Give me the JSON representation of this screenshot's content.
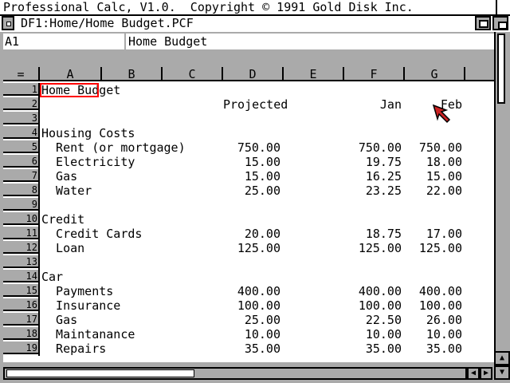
{
  "screen": {
    "title": "Professional Calc, V1.0.  Copyright © 1991 Gold Disk Inc."
  },
  "window": {
    "title": "DF1:Home/Home Budget.PCF"
  },
  "formula": {
    "cell_ref": "A1",
    "content": "Home Budget"
  },
  "columns": [
    {
      "label": "="
    },
    {
      "label": "A"
    },
    {
      "label": "B"
    },
    {
      "label": "C"
    },
    {
      "label": "D"
    },
    {
      "label": "E"
    },
    {
      "label": "F"
    },
    {
      "label": "G"
    }
  ],
  "rows": [
    {
      "num": "1",
      "a": "Home Budget",
      "d": "",
      "f": "",
      "g": ""
    },
    {
      "num": "2",
      "a": "",
      "d": "Projected",
      "f": "Jan",
      "g": "Feb"
    },
    {
      "num": "3",
      "a": "",
      "d": "",
      "f": "",
      "g": ""
    },
    {
      "num": "4",
      "a": "Housing Costs",
      "d": "",
      "f": "",
      "g": ""
    },
    {
      "num": "5",
      "a": "  Rent (or mortgage)",
      "d": "750.00",
      "f": "750.00",
      "g": "750.00"
    },
    {
      "num": "6",
      "a": "  Electricity",
      "d": "15.00",
      "f": "19.75",
      "g": "18.00"
    },
    {
      "num": "7",
      "a": "  Gas",
      "d": "15.00",
      "f": "16.25",
      "g": "15.00"
    },
    {
      "num": "8",
      "a": "  Water",
      "d": "25.00",
      "f": "23.25",
      "g": "22.00"
    },
    {
      "num": "9",
      "a": "",
      "d": "",
      "f": "",
      "g": ""
    },
    {
      "num": "10",
      "a": "Credit",
      "d": "",
      "f": "",
      "g": ""
    },
    {
      "num": "11",
      "a": "  Credit Cards",
      "d": "20.00",
      "f": "18.75",
      "g": "17.00"
    },
    {
      "num": "12",
      "a": "  Loan",
      "d": "125.00",
      "f": "125.00",
      "g": "125.00"
    },
    {
      "num": "13",
      "a": "",
      "d": "",
      "f": "",
      "g": ""
    },
    {
      "num": "14",
      "a": "Car",
      "d": "",
      "f": "",
      "g": ""
    },
    {
      "num": "15",
      "a": "  Payments",
      "d": "400.00",
      "f": "400.00",
      "g": "400.00"
    },
    {
      "num": "16",
      "a": "  Insurance",
      "d": "100.00",
      "f": "100.00",
      "g": "100.00"
    },
    {
      "num": "17",
      "a": "  Gas",
      "d": "25.00",
      "f": "22.50",
      "g": "26.00"
    },
    {
      "num": "18",
      "a": "  Maintanance",
      "d": "10.00",
      "f": "10.00",
      "g": "10.00"
    },
    {
      "num": "19",
      "a": "  Repairs",
      "d": "35.00",
      "f": "35.00",
      "g": "35.00"
    }
  ],
  "colors": {
    "background": "#aaaaaa",
    "sheet": "#ffffff",
    "active_cell": "#ff0000",
    "pointer": "#cc2222"
  }
}
